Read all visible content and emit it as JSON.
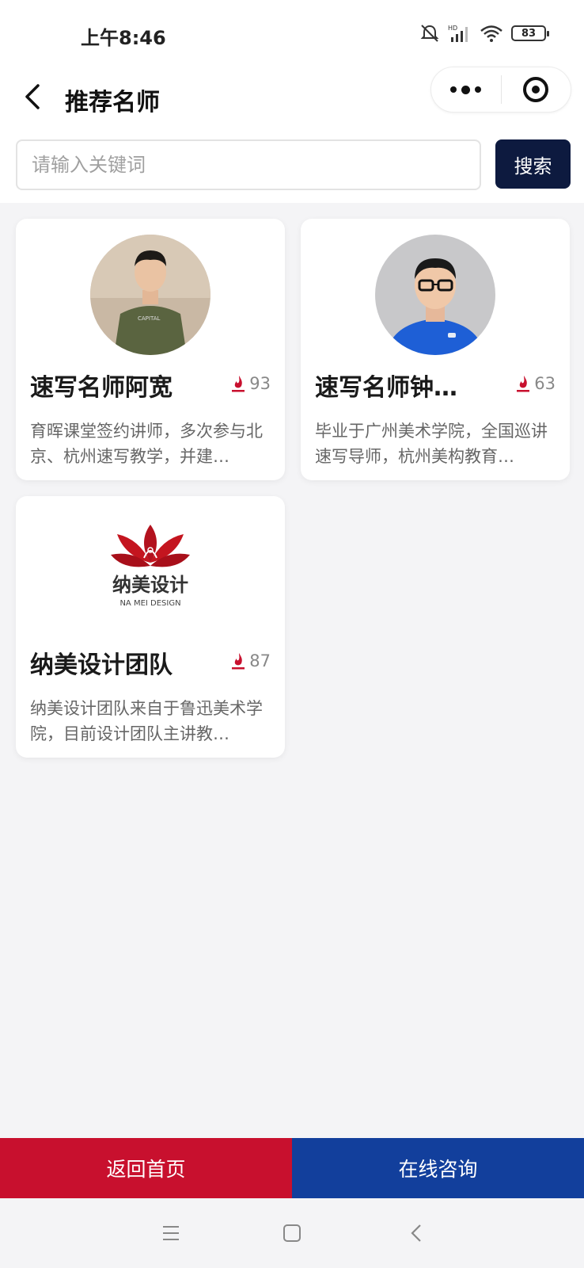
{
  "status_bar": {
    "time": "上午8:46",
    "battery": "83"
  },
  "nav": {
    "title": "推荐名师",
    "more_icon": "more-dots-icon",
    "target_icon": "record-target-icon"
  },
  "search": {
    "placeholder": "请输入关键词",
    "value": "",
    "button_label": "搜索"
  },
  "teachers": [
    {
      "name": "速写名师阿宽",
      "hot": "93",
      "desc": "育晖课堂签约讲师，多次参与北京、杭州速写教学，并建…"
    },
    {
      "name": "速写名师钟…",
      "hot": "63",
      "desc": "毕业于广州美术学院，全国巡讲速写导师，杭州美构教育…"
    },
    {
      "name": "纳美设计团队",
      "hot": "87",
      "desc": "纳美设计团队来自于鲁迅美术学院，目前设计团队主讲教…",
      "logo_text": "纳美设计",
      "logo_sub": "NA MEI DESIGN"
    }
  ],
  "bottom": {
    "home_label": "返回首页",
    "consult_label": "在线咨询"
  },
  "colors": {
    "search_button": "#0d1a3f",
    "home_button": "#c8102e",
    "consult_button": "#123f9c",
    "flame": "#c8102e"
  }
}
